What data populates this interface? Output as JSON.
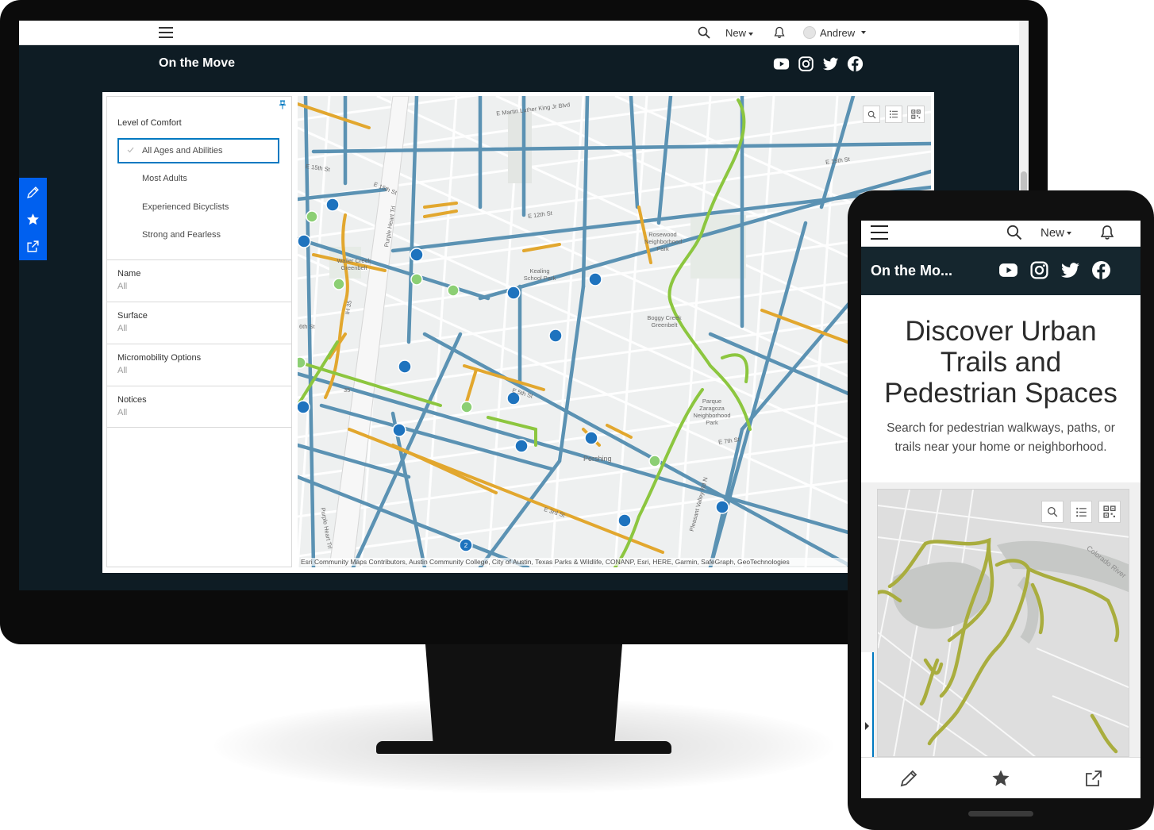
{
  "desktop": {
    "topbar": {
      "new_label": "New",
      "user_name": "Andrew"
    },
    "app_title": "On the Move",
    "social_icons": [
      "youtube-icon",
      "instagram-icon",
      "twitter-icon",
      "facebook-icon"
    ],
    "filters": {
      "level_of_comfort": {
        "title": "Level of Comfort",
        "options": [
          "All Ages and Abilities",
          "Most Adults",
          "Experienced Bicyclists",
          "Strong and Fearless"
        ],
        "selected": "All Ages and Abilities"
      },
      "fields": [
        {
          "label": "Name",
          "value": "All"
        },
        {
          "label": "Surface",
          "value": "All"
        },
        {
          "label": "Micromobility Options",
          "value": "All"
        },
        {
          "label": "Notices",
          "value": "All"
        }
      ]
    },
    "map": {
      "labels": {
        "mlk": "E Martin Luther King Jr Blvd",
        "e15_left": "E 15th St",
        "e15_mid": "E 15th St",
        "e15_right": "E 15th St",
        "e12": "E 12th St",
        "purple_heart_top": "Purple Heart Trl",
        "purple_heart_bottom": "Purple Heart Trl",
        "rosewood": "Rosewood Neighborhood Park",
        "waller": "Waller Creek Greenbelt",
        "kealing": "Kealing School Park",
        "boggy": "Boggy Creek Greenbelt",
        "zaragoza": "Parque Zaragoza Neighborhood Park",
        "e7": "E 7th St",
        "pershing": "Pershing",
        "pleasant_valley": "Pleasant Valley Rd N",
        "sixth": "6th St",
        "ih35": "IH 35",
        "hwy35": "35",
        "e5": "E 5th St",
        "e3": "E 3rd St",
        "cluster_count": "2"
      },
      "attribution": "Esri Community Maps Contributors, Austin Community College, City of Austin, Texas Parks & Wildlife, CONANP, Esri, HERE, Garmin, SafeGraph, GeoTechnologies",
      "legend_colors": {
        "all_ages": "#8cc63f",
        "most_adults": "#5b92b3",
        "experienced": "#e2a72e",
        "markers": "#1e73be"
      }
    },
    "side_tools": [
      "edit-icon",
      "favorite-icon",
      "share-icon"
    ]
  },
  "mobile": {
    "topbar": {
      "new_label": "New"
    },
    "app_title": "On the Mo...",
    "hero": {
      "title": "Discover Urban Trails and Pedestrian Spaces",
      "subtitle": "Search for pedestrian walkways, paths, or trails near your home or neighborhood."
    },
    "map_label": "Colorado River",
    "bottom_tools": [
      "edit-icon",
      "favorite-icon",
      "share-icon"
    ]
  }
}
